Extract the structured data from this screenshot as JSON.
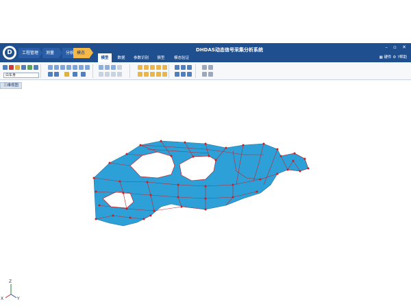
{
  "app": {
    "title": "DHDAS动态信号采集分析系统",
    "logo_icon": "dh-logo-icon"
  },
  "breadcrumbs": [
    {
      "label": "工程管理"
    },
    {
      "label": "测量"
    },
    {
      "label": "分析"
    },
    {
      "label": "模态",
      "active": true
    }
  ],
  "tabs": [
    {
      "label": "模型",
      "active": true
    },
    {
      "label": "数据"
    },
    {
      "label": "参数识别"
    },
    {
      "label": "振型"
    },
    {
      "label": "模态验证"
    }
  ],
  "right_tools": {
    "hardware_label": "硬件",
    "gear_icon": "gear-icon",
    "help_label": "?帮助"
  },
  "window_controls": [
    "minimize-icon",
    "restore-icon",
    "close-icon"
  ],
  "ribbon": {
    "model_select_value": "白车身"
  },
  "view_tab": {
    "label": "三维视图"
  },
  "colors": {
    "titlebar": "#1f4f8f",
    "active_step": "#f5b94a",
    "mesh_fill": "#2ea0d8",
    "mesh_line": "#c0242e",
    "node": "#d21a1a"
  },
  "axes_triad": {
    "z": "Z",
    "x": "X",
    "y": "Y"
  }
}
